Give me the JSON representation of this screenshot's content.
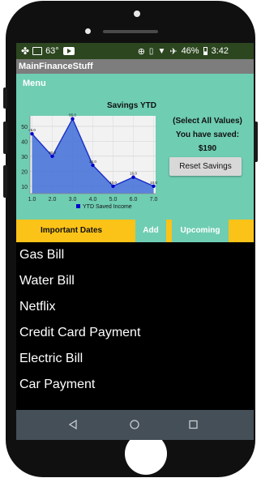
{
  "status": {
    "temperature": "63°",
    "battery": "46%",
    "time": "3:42"
  },
  "app": {
    "title": "MainFinanceStuff"
  },
  "menu": {
    "label": "Menu"
  },
  "chart_data": {
    "type": "line",
    "title": "Savings YTD",
    "series": [
      {
        "name": "YTD Saved Income",
        "x": [
          1.0,
          2.0,
          3.0,
          4.0,
          5.0,
          6.0,
          7.0
        ],
        "values": [
          45.0,
          30.0,
          55.0,
          24.0,
          10.0,
          16.0,
          10.0
        ]
      }
    ],
    "point_labels": [
      "45.0",
      "30.0",
      "55.0",
      "24.0",
      "10.0",
      "16.0",
      "10.0"
    ],
    "x_ticks": [
      "1.0",
      "2.0",
      "3.0",
      "4.0",
      "5.0",
      "6.0",
      "7.0"
    ],
    "y_ticks": [
      "10",
      "20",
      "30",
      "40",
      "50"
    ],
    "xlim": [
      0.9,
      7.1
    ],
    "ylim": [
      5,
      57
    ],
    "grid": true,
    "legend": "bottom",
    "colors": {
      "fill": "#3f6fd8",
      "line": "#1a2fc8",
      "point": "#0000cc"
    }
  },
  "savings": {
    "select_all": "(Select All Values)",
    "saved_label": "You have saved:",
    "amount": "$190",
    "reset_label": "Reset Savings"
  },
  "tabs": {
    "important": "Important Dates",
    "add": "Add",
    "upcoming": "Upcoming"
  },
  "bills": [
    "Gas Bill",
    "Water Bill",
    "Netflix",
    "Credit Card Payment",
    "Electric Bill",
    "Car Payment"
  ],
  "colors": {
    "status_bar": "#2c4620",
    "title_bar": "#7d7d7d",
    "accent_green": "#6fcdb2",
    "tab_yellow": "#fbc318",
    "nav_bar": "#444f58"
  }
}
